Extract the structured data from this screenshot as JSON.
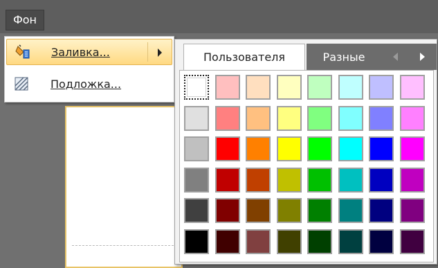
{
  "menubar": {
    "fon_label": "Фон"
  },
  "menu": {
    "items": [
      {
        "label": "Заливка...",
        "icon": "paint-bucket-icon",
        "has_submenu": true,
        "highlighted": true
      },
      {
        "label": "Подложка...",
        "icon": "background-pattern-icon",
        "has_submenu": false,
        "highlighted": false
      }
    ]
  },
  "palette": {
    "tabs": [
      {
        "label": "Пользователя",
        "active": true
      },
      {
        "label": "Разные",
        "active": false
      }
    ],
    "nav": {
      "prev_icon": "chevron-left-icon",
      "next_icon": "chevron-right-icon"
    },
    "selected": {
      "row": 0,
      "col": 0
    },
    "rows": [
      [
        "#ffffff",
        "#ffbfbf",
        "#ffdfbf",
        "#ffffbf",
        "#bfffbf",
        "#bfffff",
        "#bfbfff",
        "#ffbfff"
      ],
      [
        "#e0e0e0",
        "#ff8080",
        "#ffc080",
        "#ffff80",
        "#80ff80",
        "#80ffff",
        "#8080ff",
        "#ff80ff"
      ],
      [
        "#c0c0c0",
        "#ff0000",
        "#ff8000",
        "#ffff00",
        "#00ff00",
        "#00ffff",
        "#0000ff",
        "#ff00ff"
      ],
      [
        "#808080",
        "#c00000",
        "#c04000",
        "#c0c000",
        "#00c000",
        "#00c0c0",
        "#0000c0",
        "#c000c0"
      ],
      [
        "#404040",
        "#800000",
        "#804000",
        "#808000",
        "#008000",
        "#008080",
        "#000080",
        "#800080"
      ],
      [
        "#000000",
        "#400000",
        "#804040",
        "#404000",
        "#004000",
        "#004040",
        "#000040",
        "#400040"
      ]
    ]
  },
  "colors": {
    "menubar_bg": "#5e5e5e",
    "highlight_border": "#e3b24e",
    "page_border": "#e8c468"
  }
}
